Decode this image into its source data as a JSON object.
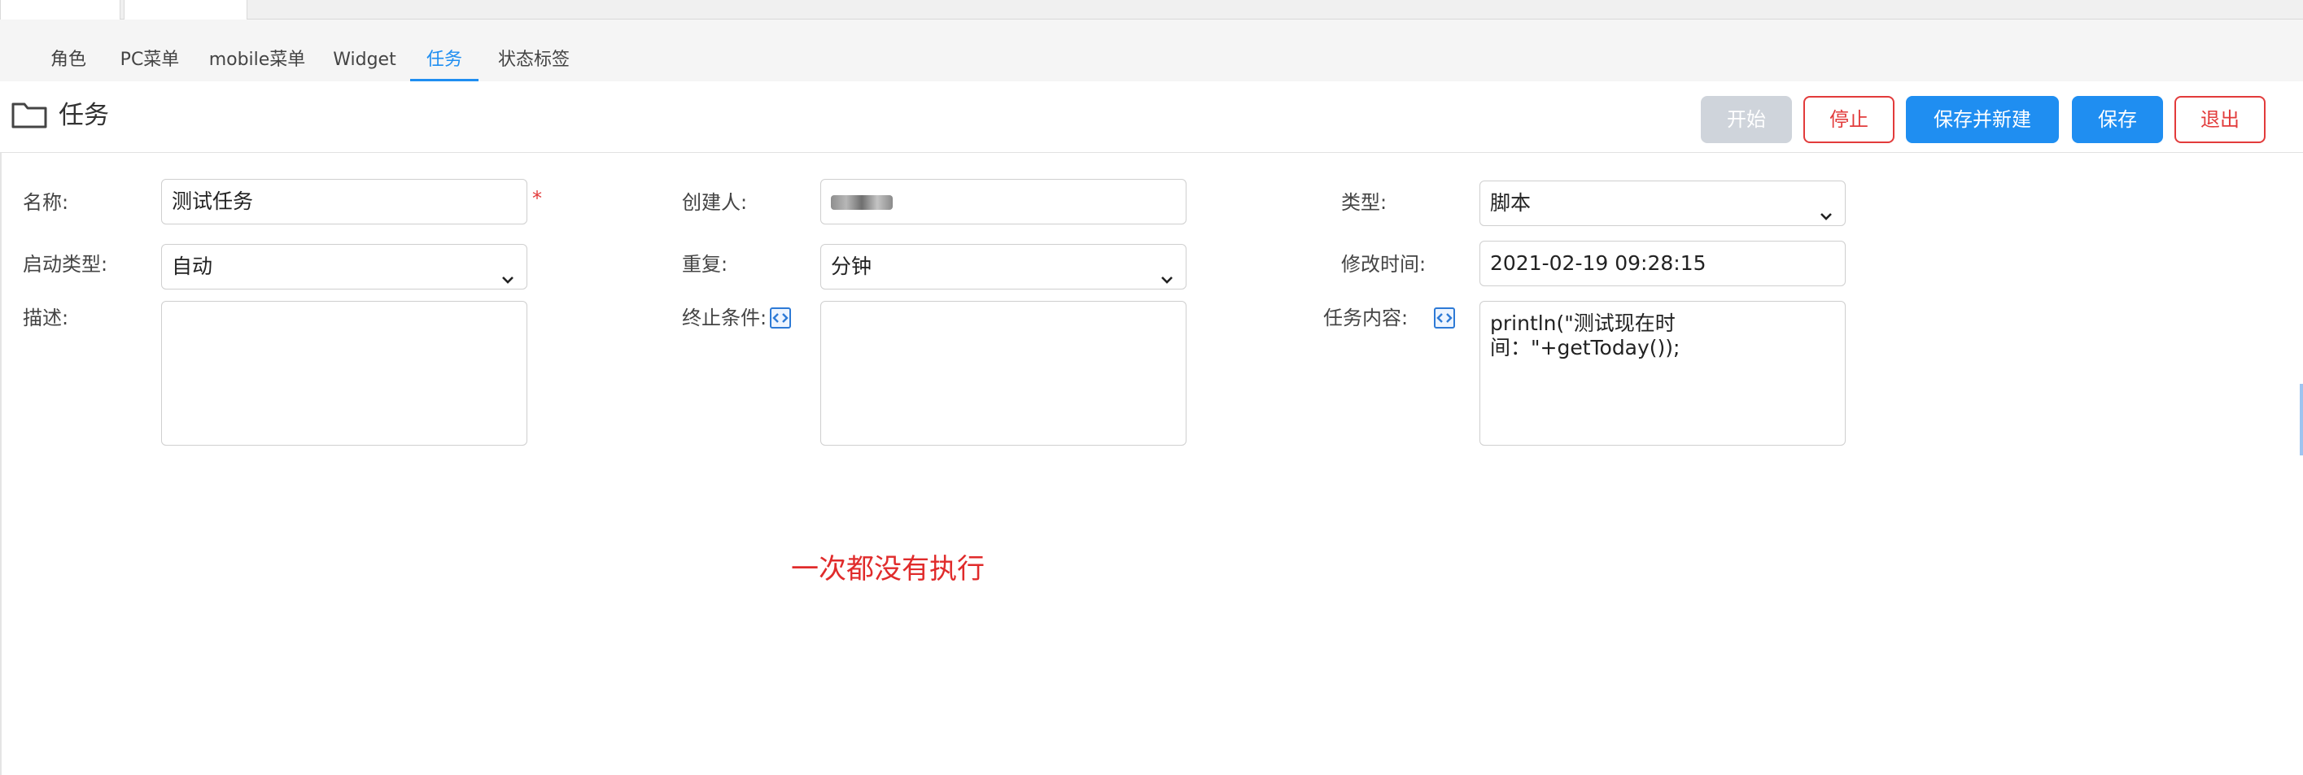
{
  "subtabs": [
    {
      "label": "角色",
      "active": false
    },
    {
      "label": "PC菜单",
      "active": false
    },
    {
      "label": "mobile菜单",
      "active": false
    },
    {
      "label": "Widget",
      "active": false
    },
    {
      "label": "任务",
      "active": true
    },
    {
      "label": "状态标签",
      "active": false
    }
  ],
  "title": {
    "text": "任务",
    "icon": "folder-icon"
  },
  "toolbar": {
    "start_label": "开始",
    "stop_label": "停止",
    "save_new_label": "保存并新建",
    "save_label": "保存",
    "exit_label": "退出"
  },
  "form": {
    "name_label": "名称:",
    "name_value": "测试任务",
    "required_mark": "*",
    "creator_label": "创建人:",
    "type_label": "类型:",
    "type_value": "脚本",
    "start_type_label": "启动类型:",
    "start_type_value": "自动",
    "repeat_label": "重复:",
    "repeat_value": "分钟",
    "modified_label": "修改时间:",
    "modified_value": "2021-02-19 09:28:15",
    "desc_label": "描述:",
    "desc_value": "",
    "end_condition_label": "终止条件:",
    "end_condition_value": "",
    "content_label": "任务内容:",
    "content_value": "println(\"测试现在时间：\"+getToday());"
  },
  "status_message": "一次都没有执行",
  "colors": {
    "primary": "#1f8ef1",
    "danger": "#e23b3b",
    "disabled": "#cfd4db",
    "status": "#e02b2b"
  }
}
